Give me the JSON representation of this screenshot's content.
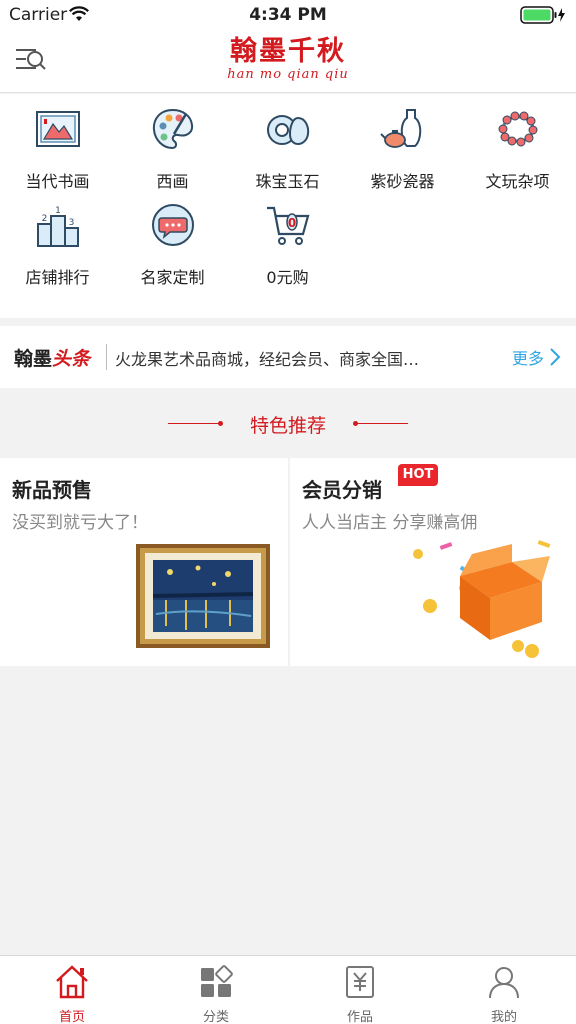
{
  "status_bar": {
    "carrier": "Carrier",
    "time": "4:34 PM"
  },
  "header": {
    "logo_cn": "翰墨千秋",
    "logo_pinyin": "han mo qian qiu"
  },
  "categories": [
    {
      "label": "当代书画",
      "icon": "painting-frame-icon"
    },
    {
      "label": "西画",
      "icon": "palette-icon"
    },
    {
      "label": "珠宝玉石",
      "icon": "jade-jewelry-icon"
    },
    {
      "label": "紫砂瓷器",
      "icon": "teapot-vase-icon"
    },
    {
      "label": "文玩杂项",
      "icon": "bead-bracelet-icon"
    },
    {
      "label": "店铺排行",
      "icon": "podium-ranking-icon"
    },
    {
      "label": "名家定制",
      "icon": "chat-custom-icon"
    },
    {
      "label": "0元购",
      "icon": "shopping-cart-icon"
    }
  ],
  "headline": {
    "brand_black": "翰墨",
    "brand_red": "头条",
    "ticker": "火龙果艺术品商城，经纪会员、商家全国…",
    "more": "更多"
  },
  "featured": {
    "title": "特色推荐"
  },
  "promos": {
    "left": {
      "title": "新品预售",
      "subtitle": "没买到就亏大了！"
    },
    "right": {
      "title": "会员分销",
      "subtitle": "人人当店主 分享赚高佣",
      "badge": "HOT"
    }
  },
  "tabs": [
    {
      "label": "首页",
      "icon": "home-icon",
      "active": true
    },
    {
      "label": "分类",
      "icon": "category-grid-icon",
      "active": false
    },
    {
      "label": "作品",
      "icon": "artwork-yen-icon",
      "active": false
    },
    {
      "label": "我的",
      "icon": "user-profile-icon",
      "active": false
    }
  ],
  "colors": {
    "brand_red": "#d21a1f",
    "link_blue": "#2fa6e2",
    "icon_blue": "#5b8fb5"
  }
}
